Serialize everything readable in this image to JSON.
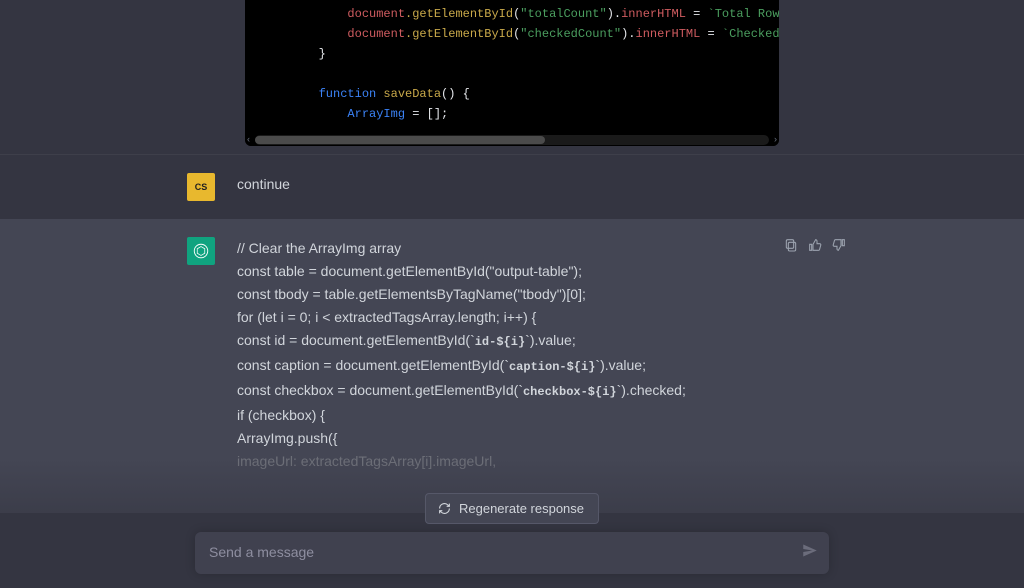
{
  "code_block": {
    "line1_a": "document",
    "line1_b": ".getElementById",
    "line1_c": "(",
    "line1_d": "\"totalCount\"",
    "line1_e": ").",
    "line1_f": "innerHTML",
    "line1_g": " = ",
    "line1_h": "`Total Rows: ${tot",
    "line2_a": "document",
    "line2_b": ".getElementById",
    "line2_c": "(",
    "line2_d": "\"checkedCount\"",
    "line2_e": ").",
    "line2_f": "innerHTML",
    "line2_g": " = ",
    "line2_h": "`Checked Rows: $",
    "line3": "}",
    "line5_a": "function",
    "line5_b": "saveData",
    "line5_c": "() {",
    "line6_a": "ArrayImg",
    "line6_b": " = [];"
  },
  "user": {
    "avatar_label": "CS",
    "message": "continue"
  },
  "assistant": {
    "lines": [
      {
        "text": "// Clear the ArrayImg array"
      },
      {
        "text": "const table = document.getElementById(\"output-table\");"
      },
      {
        "text": "const tbody = table.getElementsByTagName(\"tbody\")[0];"
      },
      {
        "text": "for (let i = 0; i < extractedTagsArray.length; i++) {"
      },
      {
        "prefix": "const id = document.getElementById(`",
        "mono": "id-${i}",
        "suffix": "`).value;"
      },
      {
        "prefix": "const caption = document.getElementById(`",
        "mono": "caption-${i}",
        "suffix": "`).value;"
      },
      {
        "prefix": "const checkbox = document.getElementById(`",
        "mono": "checkbox-${i}",
        "suffix": "`).checked;"
      },
      {
        "text": "if (checkbox) {"
      },
      {
        "text": "ArrayImg.push({"
      },
      {
        "text": "imageUrl: extractedTagsArray[i].imageUrl,",
        "faded": true
      }
    ]
  },
  "regen_label": "Regenerate response",
  "input_placeholder": "Send a message"
}
